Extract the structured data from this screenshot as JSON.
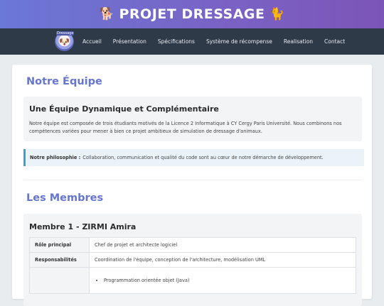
{
  "banner": {
    "title": "PROJET DRESSAGE",
    "emoji_left": "🐕",
    "emoji_right": "🐈"
  },
  "nav": {
    "logo_caption": "Dressage",
    "items": [
      "Accueil",
      "Présentation",
      "Spécifications",
      "Système de récompense",
      "Realisation",
      "Contact"
    ]
  },
  "team": {
    "heading": "Notre Équipe",
    "subheading": "Une Équipe Dynamique et Complémentaire",
    "description": "Notre équipe est composée de trois étudiants motivés de la Licence 2 Informatique à CY Cergy Paris Université. Nous combinons nos compétences variées pour mener à bien ce projet ambitieux de simulation de dressage d'animaux.",
    "philosophy_label": "Notre philosophie :",
    "philosophy_text": "Collaboration, communication et qualité du code sont au cœur de notre démarche de développement."
  },
  "members": {
    "heading": "Les Membres",
    "member1": {
      "title": "Membre 1 - ZIRMI Amira",
      "rows": [
        {
          "label": "Rôle principal",
          "value": "Chef de projet et architecte logiciel"
        },
        {
          "label": "Responsabilités",
          "value": "Coordination de l'équipe, conception de l'architecture, modélisation UML"
        }
      ],
      "skills": [
        "Programmation orientée objet (Java)"
      ]
    }
  },
  "colors": {
    "banner_gradient_start": "#6a78d6",
    "banner_gradient_end": "#7c55b8",
    "nav_bg": "#2e3a48",
    "heading": "#6676d0",
    "philosophy_border": "#3aa0cf"
  }
}
